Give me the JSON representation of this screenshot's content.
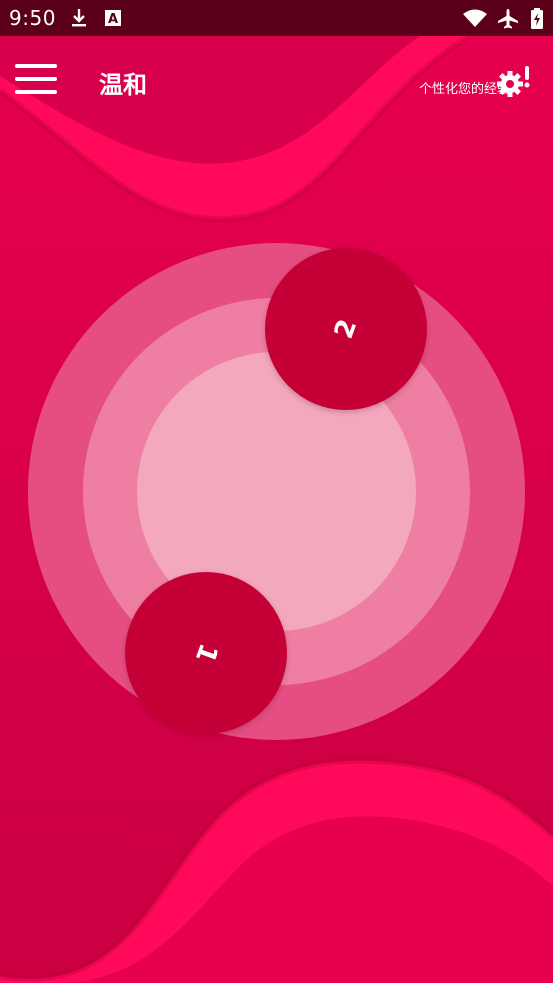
{
  "status_bar": {
    "time": "9:50",
    "icons": [
      "download-icon",
      "a-box-icon",
      "wifi-icon",
      "airplane-icon",
      "battery-charging-icon"
    ]
  },
  "app_bar": {
    "title": "温和",
    "personalize_text": "个性化您的经验",
    "menu_icon": "hamburger-menu-icon",
    "settings_icon": "gear-alert-icon"
  },
  "colors": {
    "background": "#e0004c",
    "status_bar": "#5a0018",
    "ring_outer": "#e64e83",
    "ring_middle": "#ee7fa3",
    "ring_inner": "#f3a8bd",
    "handle": "#c40037"
  },
  "rings": {
    "handles": [
      {
        "label": "2"
      },
      {
        "label": "1"
      }
    ]
  }
}
